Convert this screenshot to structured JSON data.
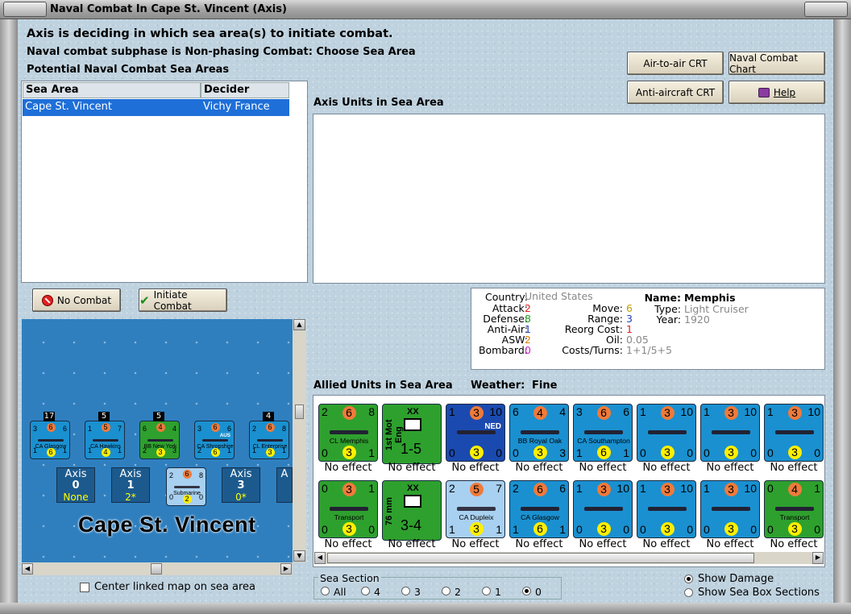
{
  "window": {
    "title": "Naval Combat In Cape St. Vincent (Axis)"
  },
  "header": {
    "line1": "Axis is deciding in which sea area(s) to initiate combat.",
    "line2": "Naval combat subphase is Non-phasing Combat: Choose Sea Area",
    "line3": "Potential Naval Combat Sea Areas"
  },
  "buttons": {
    "air_to_air": "Air-to-air CRT",
    "naval_chart": "Naval Combat Chart",
    "anti_aircraft": "Anti-aircraft CRT",
    "help": "Help",
    "no_combat": "No Combat",
    "initiate": "Initiate Combat"
  },
  "sea_table": {
    "col1": "Sea Area",
    "col2": "Decider",
    "rows": [
      {
        "area": "Cape St. Vincent",
        "decider": "Vichy France"
      }
    ]
  },
  "axis_units_label": "Axis Units in Sea Area",
  "info": {
    "country_label": "Country:",
    "country": "United States",
    "attack_label": "Attack:",
    "attack": "2",
    "defense_label": "Defense:",
    "defense": "8",
    "antiair_label": "Anti-Air:",
    "antiair": "1",
    "asw_label": "ASW:",
    "asw": "2",
    "bombard_label": "Bombard:",
    "bombard": "0",
    "move_label": "Move:",
    "move": "6",
    "range_label": "Range:",
    "range": "3",
    "reorg_label": "Reorg Cost:",
    "reorg": "1",
    "oil_label": "Oil:",
    "oil": "0.05",
    "costs_label": "Costs/Turns:",
    "costs": "1+1/5+5",
    "name_label": "Name:",
    "name": "Memphis",
    "type_label": "Type:",
    "type": "Light Cruiser",
    "year_label": "Year:",
    "year": "1920",
    "colors": {
      "attack": "#e02020",
      "defense": "#20a020",
      "antiair": "#2040c0",
      "asw": "#e08000",
      "bombard": "#d020d0",
      "move": "#c0a000",
      "range": "#2040c0",
      "reorg": "#e02020"
    }
  },
  "allied": {
    "label": "Allied Units in Sea Area",
    "weather_label": "Weather:",
    "weather": "Fine",
    "row1": [
      {
        "l": "2",
        "m": "6",
        "r": "8",
        "name": "CL Memphis",
        "bl": "0",
        "bm": "3",
        "br": "1",
        "bg": "#2ea02e",
        "status": "No effect"
      },
      {
        "kind": "land",
        "side": "1st Mot Eng",
        "top": "XX",
        "val": "1-5",
        "bg": "#2ea02e",
        "status": "No effect"
      },
      {
        "l": "1",
        "m": "3",
        "r": "10",
        "name": "",
        "tag": "NED",
        "bl": "0",
        "bm": "3",
        "br": "0",
        "bg": "#1a4ab0",
        "status": "No effect"
      },
      {
        "l": "6",
        "m": "4",
        "r": "4",
        "name": "BB Royal Oak",
        "bl": "0",
        "bm": "3",
        "br": "3",
        "bg": "#1a90d0",
        "status": "No effect"
      },
      {
        "l": "3",
        "m": "6",
        "r": "6",
        "name": "CA Southampton",
        "bl": "1",
        "bm": "6",
        "br": "1",
        "bg": "#1a90d0",
        "status": "No effect"
      },
      {
        "l": "1",
        "m": "3",
        "r": "10",
        "name": "",
        "bl": "0",
        "bm": "3",
        "br": "0",
        "bg": "#1a90d0",
        "status": "No effect"
      },
      {
        "l": "1",
        "m": "3",
        "r": "10",
        "name": "",
        "bl": "0",
        "bm": "3",
        "br": "0",
        "bg": "#1a90d0",
        "status": "No effect"
      },
      {
        "l": "1",
        "m": "3",
        "r": "10",
        "name": "",
        "bl": "0",
        "bm": "3",
        "br": "0",
        "bg": "#1a90d0",
        "status": "No effect"
      }
    ],
    "row2": [
      {
        "l": "0",
        "m": "3",
        "r": "1",
        "name": "Transport",
        "bl": "0",
        "bm": "3",
        "br": "0",
        "bg": "#2ea02e",
        "status": "No effect"
      },
      {
        "kind": "land",
        "side": "76 mm",
        "top": "XX",
        "val": "3-4",
        "bg": "#2ea02e",
        "status": "No effect"
      },
      {
        "l": "2",
        "m": "5",
        "r": "7",
        "name": "CA Dupleix",
        "bl": "1",
        "bm": "3",
        "br": "1",
        "bg": "#a8d0f0",
        "status": "No effect"
      },
      {
        "l": "2",
        "m": "6",
        "r": "6",
        "name": "CA Glasgow",
        "bl": "1",
        "bm": "6",
        "br": "1",
        "bg": "#1a90d0",
        "status": "No effect"
      },
      {
        "l": "1",
        "m": "3",
        "r": "10",
        "name": "",
        "bl": "0",
        "bm": "3",
        "br": "0",
        "bg": "#1a90d0",
        "status": "No effect"
      },
      {
        "l": "1",
        "m": "3",
        "r": "10",
        "name": "",
        "bl": "0",
        "bm": "3",
        "br": "0",
        "bg": "#1a90d0",
        "status": "No effect"
      },
      {
        "l": "1",
        "m": "3",
        "r": "10",
        "name": "",
        "bl": "0",
        "bm": "3",
        "br": "0",
        "bg": "#1a90d0",
        "status": "No effect"
      },
      {
        "l": "0",
        "m": "4",
        "r": "1",
        "name": "Transport",
        "bl": "0",
        "bm": "3",
        "br": "0",
        "bg": "#2ea02e",
        "status": "No effect"
      }
    ]
  },
  "map": {
    "name": "Cape St. Vincent",
    "stacks": [
      {
        "count": "17",
        "l": "3",
        "m": "6",
        "r": "6",
        "name": "CA Glasgow",
        "bl": "1",
        "bm": "6",
        "br": "1",
        "bg": "#1a90d0"
      },
      {
        "count": "5",
        "l": "1",
        "m": "5",
        "r": "7",
        "name": "CA Hawkins",
        "bl": "1",
        "bm": "4",
        "br": "1",
        "bg": "#1a90d0"
      },
      {
        "count": "5",
        "l": "6",
        "m": "4",
        "r": "4",
        "name": "BB New York",
        "bl": "2",
        "bm": "3",
        "br": "3",
        "bg": "#2ea02e"
      },
      {
        "count": "",
        "l": "3",
        "m": "6",
        "r": "6",
        "name": "CA Shropshire",
        "tag": "AUS",
        "bl": "2",
        "bm": "6",
        "br": "1",
        "bg": "#1a90d0"
      },
      {
        "count": "4",
        "l": "2",
        "m": "6",
        "r": "8",
        "name": "CL Enterprise",
        "bl": "1",
        "bm": "3",
        "br": "1",
        "bg": "#1a90d0"
      }
    ],
    "boxes": [
      {
        "t": "Axis",
        "n": "0",
        "s": "None"
      },
      {
        "t": "Axis",
        "n": "1",
        "s": "2*"
      },
      {
        "t": "Axis",
        "n": "3",
        "s": "0*"
      },
      {
        "t": "A",
        "n": "",
        "s": ""
      }
    ],
    "sub": {
      "l": "2",
      "m": "6",
      "r": "8",
      "name": "Submarine",
      "bl": "0",
      "bm": "2",
      "br": "0"
    }
  },
  "center_map_label": "Center linked map on sea area",
  "sea_section": {
    "label": "Sea Section",
    "options": [
      "All",
      "4",
      "3",
      "2",
      "1",
      "0"
    ],
    "selected": "0"
  },
  "display": {
    "show_damage": "Show Damage",
    "show_sections": "Show Sea Box Sections",
    "selected": "Show Damage"
  }
}
